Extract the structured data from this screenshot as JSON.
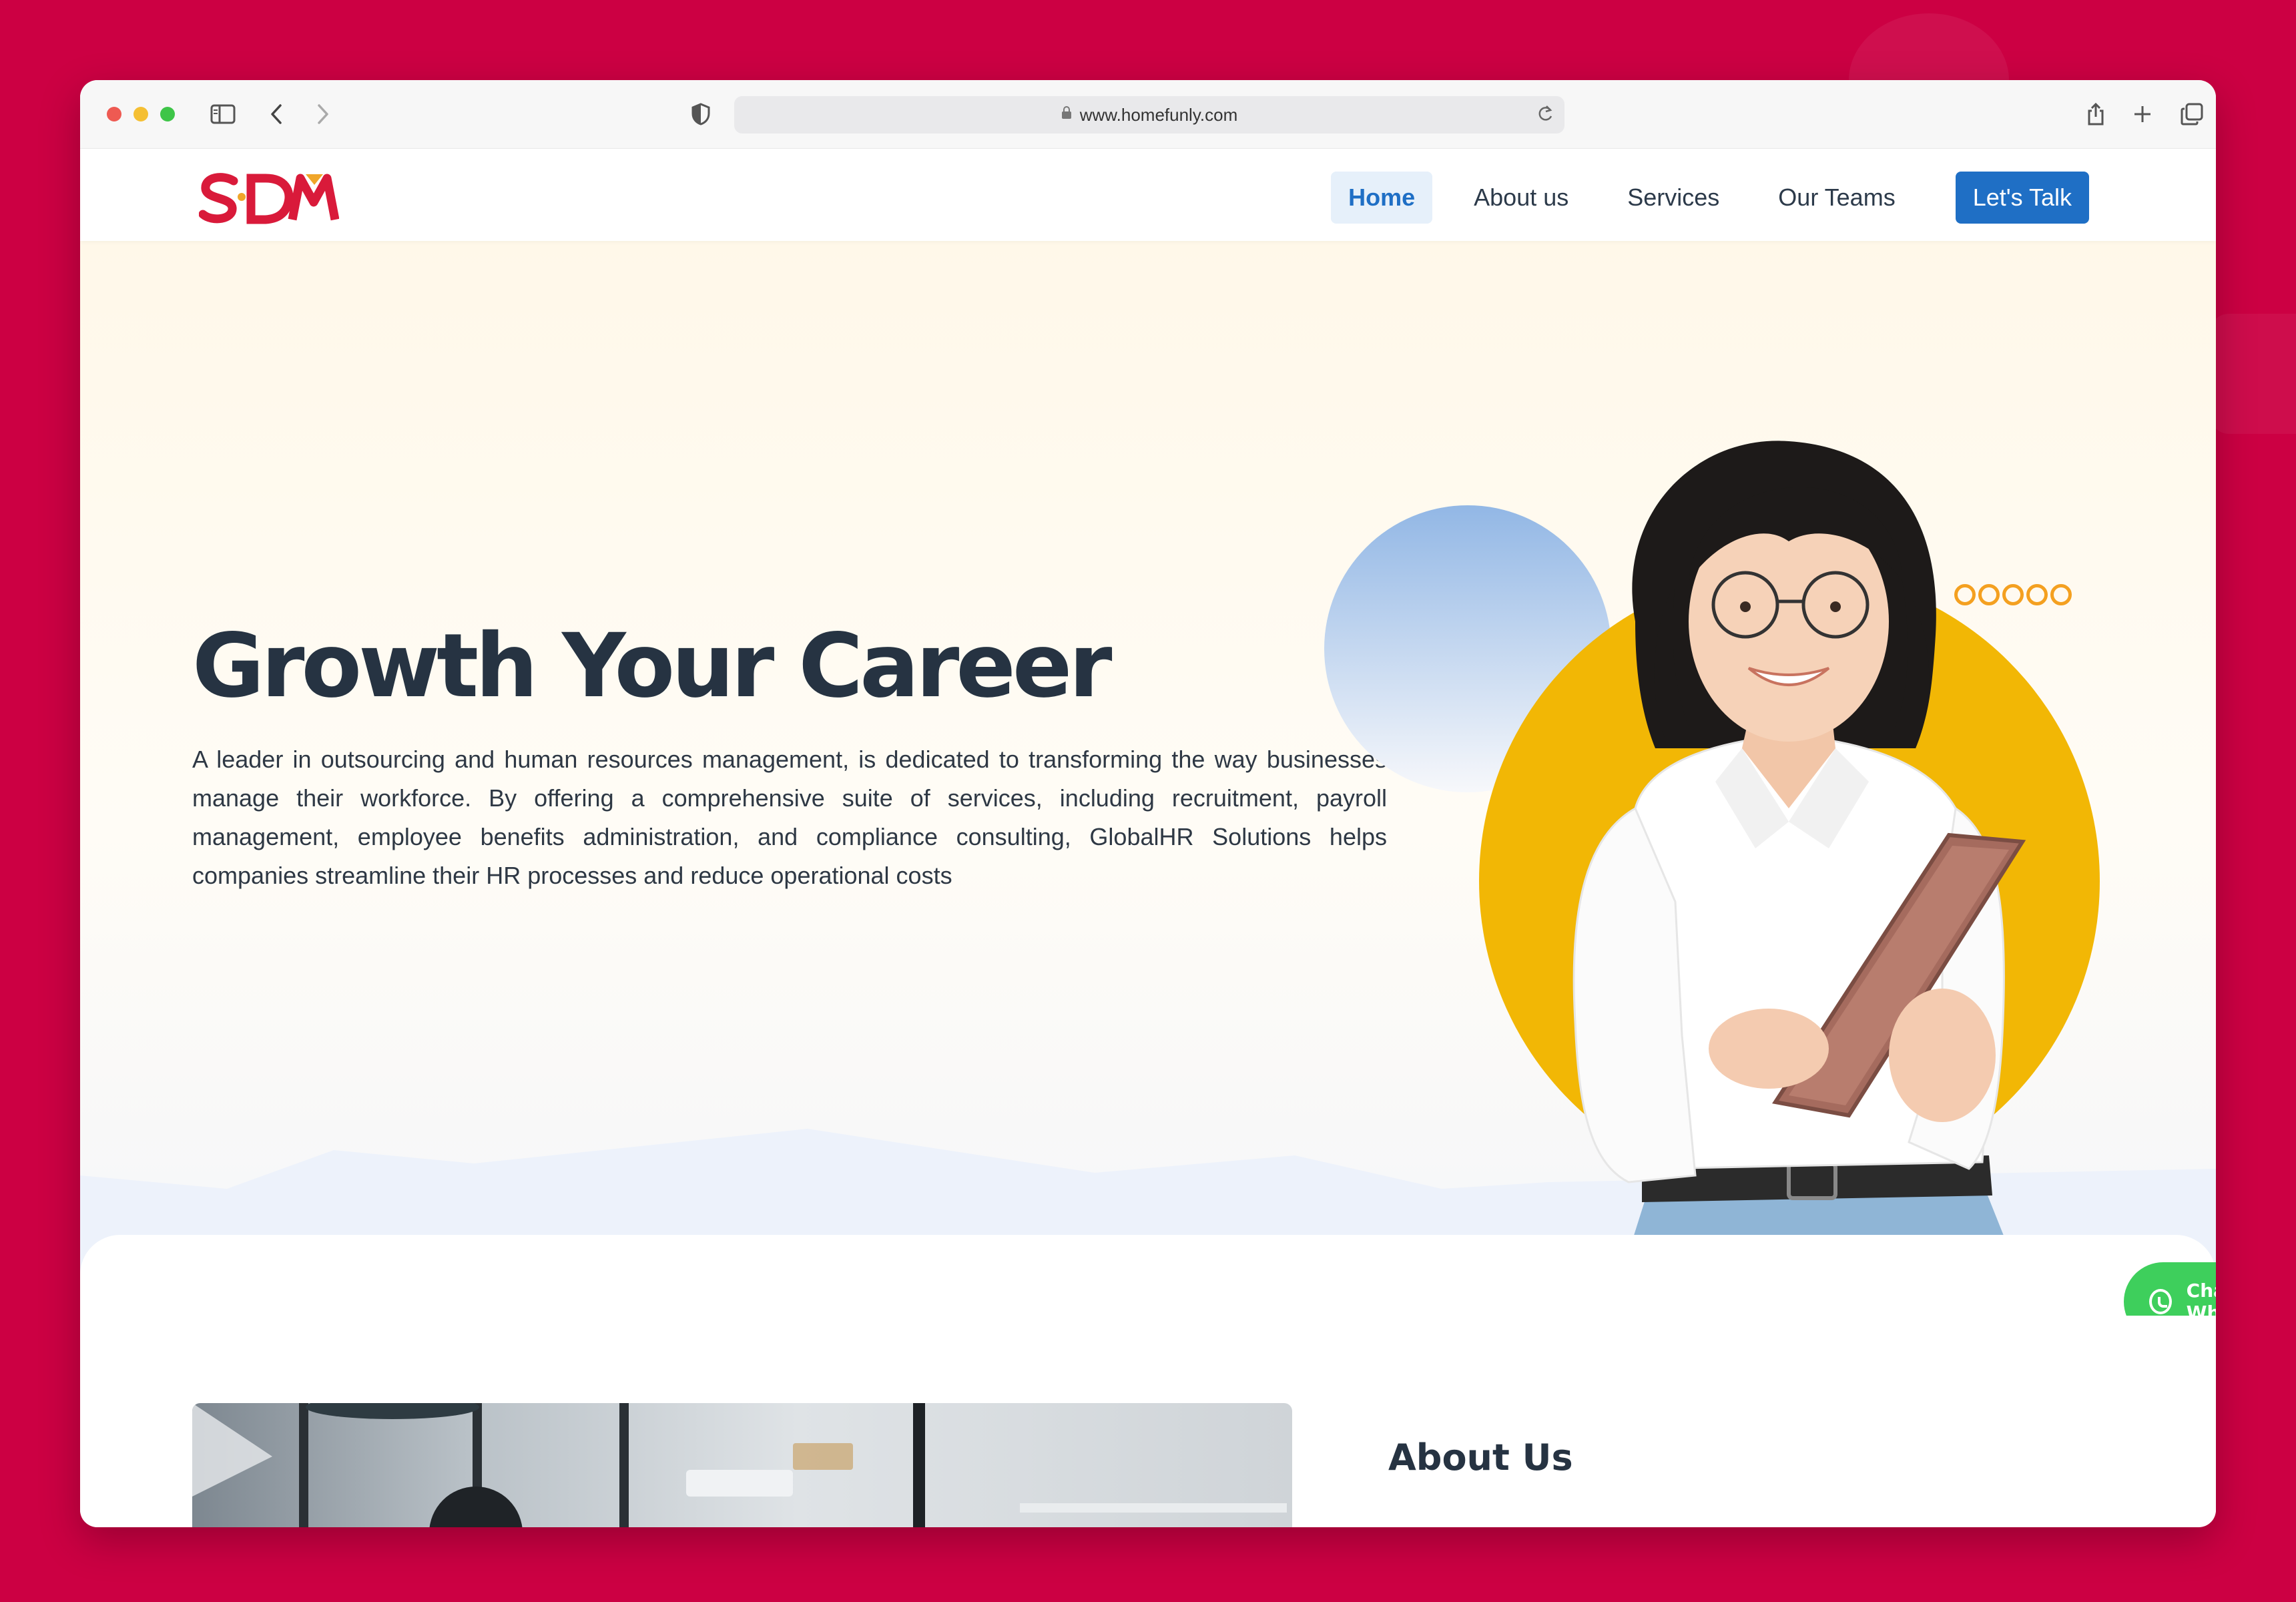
{
  "browser": {
    "url": "www.homefunly.com"
  },
  "site": {
    "logo": "SDM",
    "nav": {
      "items": [
        {
          "label": "Home",
          "active": true
        },
        {
          "label": "About us",
          "active": false
        },
        {
          "label": "Services",
          "active": false
        },
        {
          "label": "Our Teams",
          "active": false
        }
      ],
      "cta": "Let's Talk"
    }
  },
  "hero": {
    "title": "Growth Your Career",
    "description": "A leader in outsourcing and human resources management, is dedicated to transforming the way businesses manage their workforce. By offering a comprehensive suite of services, including recruitment, payroll management, employee benefits administration, and compliance consulting, GlobalHR Solutions helps companies streamline their HR processes and reduce operational costs"
  },
  "whatsapp": {
    "label": "Chat Whatsapp"
  },
  "about": {
    "title": "About Us"
  },
  "colors": {
    "background": "#cc0043",
    "brand_red": "#d91a3a",
    "primary_blue": "#1f6fc5",
    "yellow": "#f2b705",
    "whatsapp_green": "#3ecf5c",
    "text_dark": "#263342"
  }
}
